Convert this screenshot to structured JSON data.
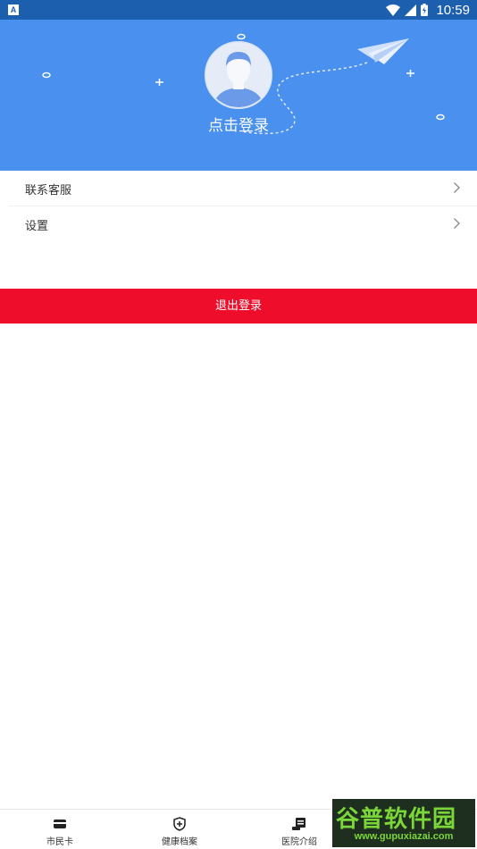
{
  "status_bar": {
    "time": "10:59",
    "icons": [
      "notification-a-icon",
      "wifi-icon",
      "signal-icon",
      "battery-icon"
    ]
  },
  "header": {
    "login_label": "点击登录",
    "background_color": "#4a90ef"
  },
  "menu": {
    "items": [
      {
        "label": "联系客服",
        "icon": "chevron-right-icon"
      },
      {
        "label": "设置",
        "icon": "chevron-right-icon"
      }
    ]
  },
  "logout": {
    "label": "退出登录",
    "color": "#ef0d2c"
  },
  "bottom_nav": {
    "items": [
      {
        "label": "市民卡",
        "icon": "card-icon"
      },
      {
        "label": "健康档案",
        "icon": "health-shield-icon"
      },
      {
        "label": "医院介绍",
        "icon": "hospital-info-icon"
      }
    ]
  },
  "watermark": {
    "title": "谷普软件园",
    "url": "www.gupuxiazai.com"
  }
}
